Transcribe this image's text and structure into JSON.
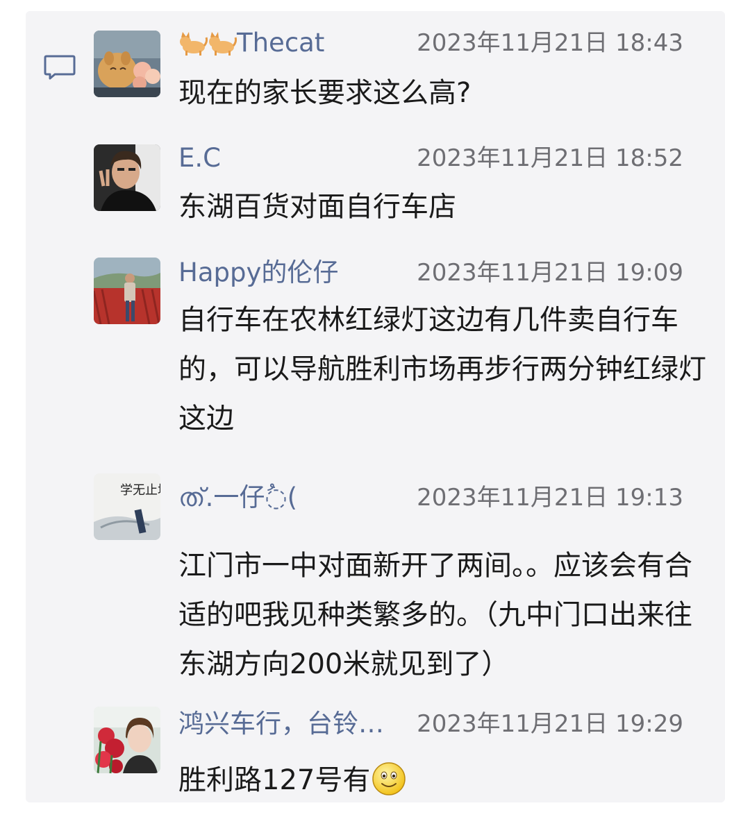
{
  "comments": [
    {
      "user": "Thecat",
      "user_prefix_icons": [
        "cat-emoji",
        "cat-emoji"
      ],
      "time": "2023年11月21日 18:43",
      "text": "现在的家长要求这么高?",
      "avatar": "cat-with-flowers-avatar"
    },
    {
      "user": "E.C",
      "time": "2023年11月21日 18:52",
      "text": "东湖百货对面自行车店",
      "avatar": "man-peace-sign-avatar"
    },
    {
      "user": "Happy的伦仔",
      "time": "2023年11月21日 19:09",
      "text": "自行车在农林红绿灯这边有几件卖自行车的，可以导航胜利市场再步行两分钟红绿灯这边",
      "avatar": "man-outdoor-red-ribbons-avatar"
    },
    {
      "user": "ത്.一仔◌ُ(",
      "time": "2023年11月21日 19:13",
      "text": "江门市一中对面新开了两间。。应该会有合适的吧我见种类繁多的。（九中门口出来往东湖方向200米就见到了）",
      "avatar": "calligraphy-xue-wu-zhi-jing-avatar",
      "avatar_text": "学无止境"
    },
    {
      "user": "鸿兴车行，台铃…",
      "time": "2023年11月21日 19:29",
      "text": "胜利路127号有",
      "text_suffix_icon": "smiley-emoji",
      "avatar": "woman-red-flowers-avatar"
    }
  ],
  "colors": {
    "username": "#576b95",
    "timestamp": "#6e6e73",
    "background": "#f4f4f6"
  }
}
